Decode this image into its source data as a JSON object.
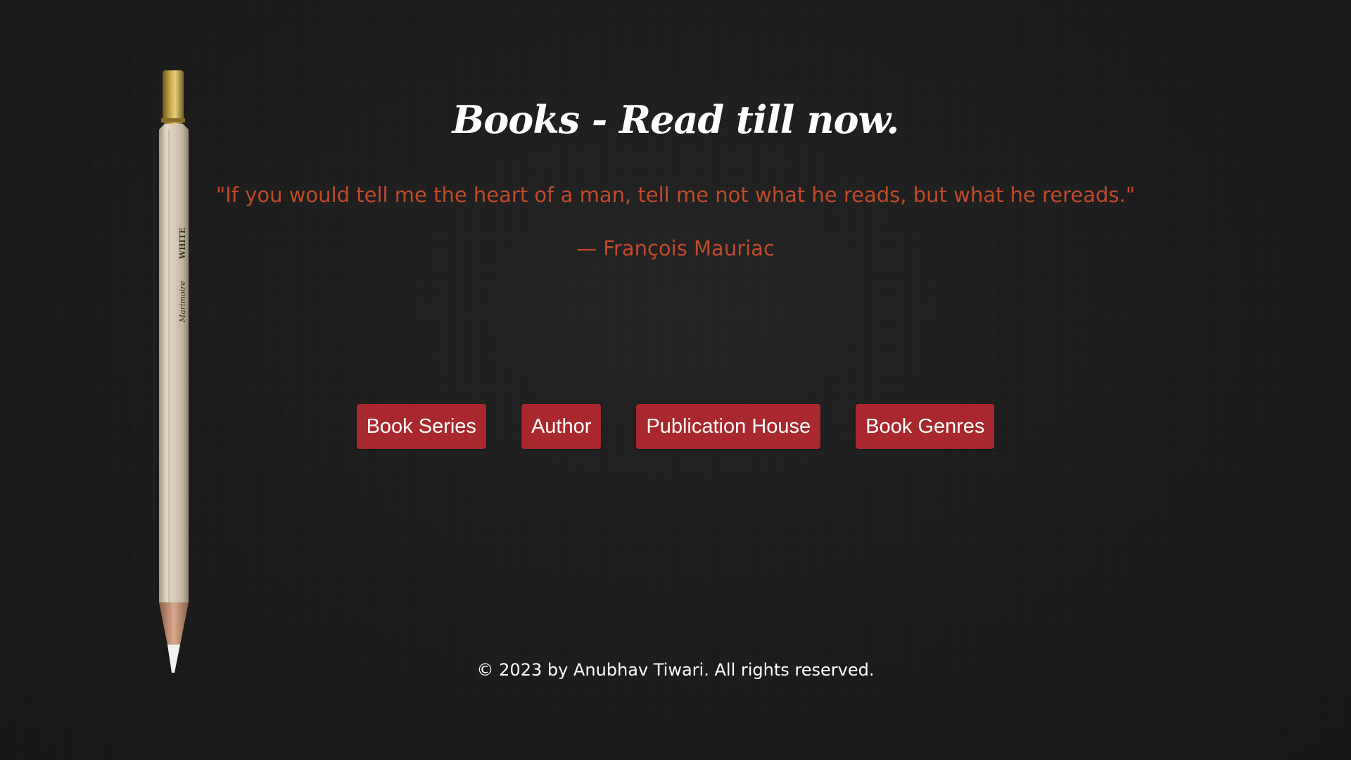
{
  "header": {
    "title": "Books - Read till now."
  },
  "quote": {
    "text": "\"If you would tell me the heart of a man, tell me not what he reads, but what he rereads.\"",
    "attribution": "— François Mauriac"
  },
  "nav": {
    "items": [
      {
        "label": "Book Series"
      },
      {
        "label": "Author"
      },
      {
        "label": "Publication House"
      },
      {
        "label": "Book Genres"
      }
    ]
  },
  "footer": {
    "text": "© 2023 by Anubhav Tiwari. All rights reserved."
  },
  "decoration": {
    "pencil_icon": "pencil-icon"
  },
  "colors": {
    "background": "#1c1c1c",
    "accent_quote": "#c24a2a",
    "button_bg": "#a8282d",
    "text": "#ffffff"
  }
}
